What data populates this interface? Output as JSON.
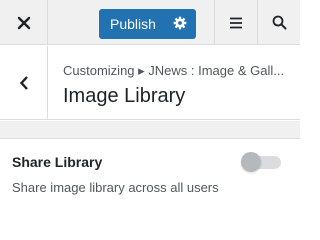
{
  "toolbar": {
    "publish_label": "Publish"
  },
  "header": {
    "breadcrumb": "Customizing ▸ JNews : Image & Gall...",
    "title": "Image Library"
  },
  "option": {
    "title": "Share Library",
    "description": "Share image library across all users",
    "enabled": false
  },
  "colors": {
    "accent": "#2271b1",
    "toolbar_bg": "#f0f0f1",
    "toggle_off": "#b4b9be"
  },
  "icons": [
    "close-icon",
    "gear-icon",
    "menu-icon",
    "search-icon",
    "chevron-left-icon"
  ]
}
